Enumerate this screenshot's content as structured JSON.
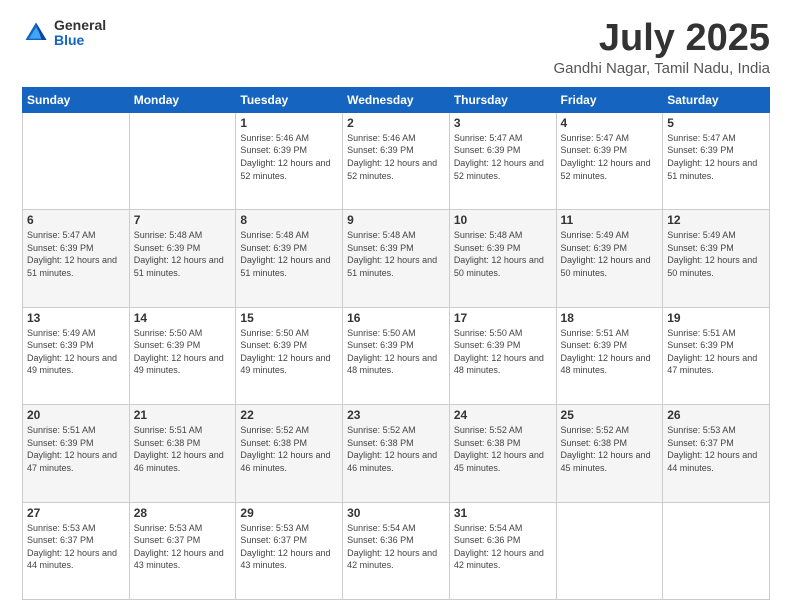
{
  "logo": {
    "general": "General",
    "blue": "Blue"
  },
  "title": "July 2025",
  "location": "Gandhi Nagar, Tamil Nadu, India",
  "days_of_week": [
    "Sunday",
    "Monday",
    "Tuesday",
    "Wednesday",
    "Thursday",
    "Friday",
    "Saturday"
  ],
  "weeks": [
    [
      {
        "day": "",
        "sunrise": "",
        "sunset": "",
        "daylight": ""
      },
      {
        "day": "",
        "sunrise": "",
        "sunset": "",
        "daylight": ""
      },
      {
        "day": "1",
        "sunrise": "Sunrise: 5:46 AM",
        "sunset": "Sunset: 6:39 PM",
        "daylight": "Daylight: 12 hours and 52 minutes."
      },
      {
        "day": "2",
        "sunrise": "Sunrise: 5:46 AM",
        "sunset": "Sunset: 6:39 PM",
        "daylight": "Daylight: 12 hours and 52 minutes."
      },
      {
        "day": "3",
        "sunrise": "Sunrise: 5:47 AM",
        "sunset": "Sunset: 6:39 PM",
        "daylight": "Daylight: 12 hours and 52 minutes."
      },
      {
        "day": "4",
        "sunrise": "Sunrise: 5:47 AM",
        "sunset": "Sunset: 6:39 PM",
        "daylight": "Daylight: 12 hours and 52 minutes."
      },
      {
        "day": "5",
        "sunrise": "Sunrise: 5:47 AM",
        "sunset": "Sunset: 6:39 PM",
        "daylight": "Daylight: 12 hours and 51 minutes."
      }
    ],
    [
      {
        "day": "6",
        "sunrise": "Sunrise: 5:47 AM",
        "sunset": "Sunset: 6:39 PM",
        "daylight": "Daylight: 12 hours and 51 minutes."
      },
      {
        "day": "7",
        "sunrise": "Sunrise: 5:48 AM",
        "sunset": "Sunset: 6:39 PM",
        "daylight": "Daylight: 12 hours and 51 minutes."
      },
      {
        "day": "8",
        "sunrise": "Sunrise: 5:48 AM",
        "sunset": "Sunset: 6:39 PM",
        "daylight": "Daylight: 12 hours and 51 minutes."
      },
      {
        "day": "9",
        "sunrise": "Sunrise: 5:48 AM",
        "sunset": "Sunset: 6:39 PM",
        "daylight": "Daylight: 12 hours and 51 minutes."
      },
      {
        "day": "10",
        "sunrise": "Sunrise: 5:48 AM",
        "sunset": "Sunset: 6:39 PM",
        "daylight": "Daylight: 12 hours and 50 minutes."
      },
      {
        "day": "11",
        "sunrise": "Sunrise: 5:49 AM",
        "sunset": "Sunset: 6:39 PM",
        "daylight": "Daylight: 12 hours and 50 minutes."
      },
      {
        "day": "12",
        "sunrise": "Sunrise: 5:49 AM",
        "sunset": "Sunset: 6:39 PM",
        "daylight": "Daylight: 12 hours and 50 minutes."
      }
    ],
    [
      {
        "day": "13",
        "sunrise": "Sunrise: 5:49 AM",
        "sunset": "Sunset: 6:39 PM",
        "daylight": "Daylight: 12 hours and 49 minutes."
      },
      {
        "day": "14",
        "sunrise": "Sunrise: 5:50 AM",
        "sunset": "Sunset: 6:39 PM",
        "daylight": "Daylight: 12 hours and 49 minutes."
      },
      {
        "day": "15",
        "sunrise": "Sunrise: 5:50 AM",
        "sunset": "Sunset: 6:39 PM",
        "daylight": "Daylight: 12 hours and 49 minutes."
      },
      {
        "day": "16",
        "sunrise": "Sunrise: 5:50 AM",
        "sunset": "Sunset: 6:39 PM",
        "daylight": "Daylight: 12 hours and 48 minutes."
      },
      {
        "day": "17",
        "sunrise": "Sunrise: 5:50 AM",
        "sunset": "Sunset: 6:39 PM",
        "daylight": "Daylight: 12 hours and 48 minutes."
      },
      {
        "day": "18",
        "sunrise": "Sunrise: 5:51 AM",
        "sunset": "Sunset: 6:39 PM",
        "daylight": "Daylight: 12 hours and 48 minutes."
      },
      {
        "day": "19",
        "sunrise": "Sunrise: 5:51 AM",
        "sunset": "Sunset: 6:39 PM",
        "daylight": "Daylight: 12 hours and 47 minutes."
      }
    ],
    [
      {
        "day": "20",
        "sunrise": "Sunrise: 5:51 AM",
        "sunset": "Sunset: 6:39 PM",
        "daylight": "Daylight: 12 hours and 47 minutes."
      },
      {
        "day": "21",
        "sunrise": "Sunrise: 5:51 AM",
        "sunset": "Sunset: 6:38 PM",
        "daylight": "Daylight: 12 hours and 46 minutes."
      },
      {
        "day": "22",
        "sunrise": "Sunrise: 5:52 AM",
        "sunset": "Sunset: 6:38 PM",
        "daylight": "Daylight: 12 hours and 46 minutes."
      },
      {
        "day": "23",
        "sunrise": "Sunrise: 5:52 AM",
        "sunset": "Sunset: 6:38 PM",
        "daylight": "Daylight: 12 hours and 46 minutes."
      },
      {
        "day": "24",
        "sunrise": "Sunrise: 5:52 AM",
        "sunset": "Sunset: 6:38 PM",
        "daylight": "Daylight: 12 hours and 45 minutes."
      },
      {
        "day": "25",
        "sunrise": "Sunrise: 5:52 AM",
        "sunset": "Sunset: 6:38 PM",
        "daylight": "Daylight: 12 hours and 45 minutes."
      },
      {
        "day": "26",
        "sunrise": "Sunrise: 5:53 AM",
        "sunset": "Sunset: 6:37 PM",
        "daylight": "Daylight: 12 hours and 44 minutes."
      }
    ],
    [
      {
        "day": "27",
        "sunrise": "Sunrise: 5:53 AM",
        "sunset": "Sunset: 6:37 PM",
        "daylight": "Daylight: 12 hours and 44 minutes."
      },
      {
        "day": "28",
        "sunrise": "Sunrise: 5:53 AM",
        "sunset": "Sunset: 6:37 PM",
        "daylight": "Daylight: 12 hours and 43 minutes."
      },
      {
        "day": "29",
        "sunrise": "Sunrise: 5:53 AM",
        "sunset": "Sunset: 6:37 PM",
        "daylight": "Daylight: 12 hours and 43 minutes."
      },
      {
        "day": "30",
        "sunrise": "Sunrise: 5:54 AM",
        "sunset": "Sunset: 6:36 PM",
        "daylight": "Daylight: 12 hours and 42 minutes."
      },
      {
        "day": "31",
        "sunrise": "Sunrise: 5:54 AM",
        "sunset": "Sunset: 6:36 PM",
        "daylight": "Daylight: 12 hours and 42 minutes."
      },
      {
        "day": "",
        "sunrise": "",
        "sunset": "",
        "daylight": ""
      },
      {
        "day": "",
        "sunrise": "",
        "sunset": "",
        "daylight": ""
      }
    ]
  ]
}
